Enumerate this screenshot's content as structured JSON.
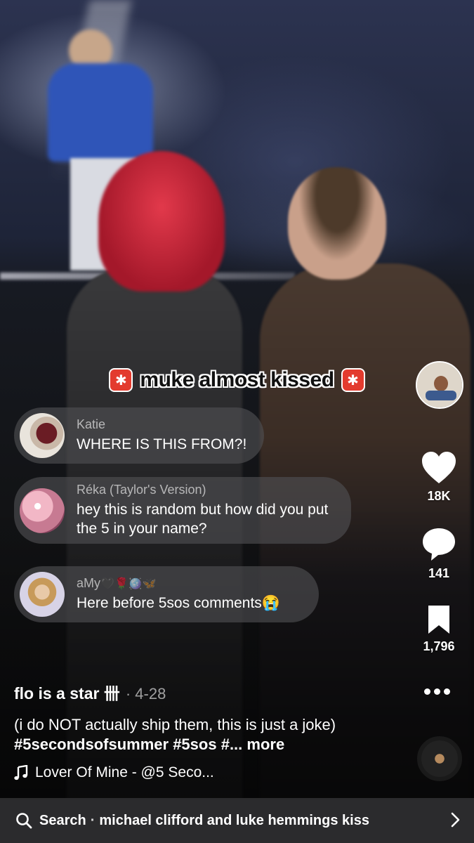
{
  "overlay_caption": {
    "text": "muke almost kissed",
    "left_icon": "siren-emoji",
    "right_icon": "siren-emoji"
  },
  "comments": [
    {
      "name": "Katie",
      "text": "WHERE IS THIS FROM?!"
    },
    {
      "name": "Réka (Taylor's Version)",
      "text": "hey this is random but how did you put the 5 in your name?"
    },
    {
      "name": "aMy",
      "name_emojis": "🖤🌹🪩🦋",
      "text": "Here before 5sos comments😭"
    }
  ],
  "rail": {
    "likes": "18K",
    "comments": "141",
    "saves": "1,796"
  },
  "post": {
    "author": "flo is a star",
    "author_glyph": "卌",
    "date": "4-28",
    "description_plain": "(i do NOT actually ship them, this is just a joke) ",
    "description_tags": "#5secondsofsummer #5sos #",
    "more": "... more",
    "music": "Lover Of Mine - @5 Seco..."
  },
  "search": {
    "label": "Search",
    "separator": "·",
    "query": "michael clifford and luke hemmings kiss"
  },
  "colors": {
    "caption_red": "#e33b2e",
    "searchbar_bg": "#2b2b2d",
    "comment_bubble": "rgba(80,80,84,0.62)"
  }
}
